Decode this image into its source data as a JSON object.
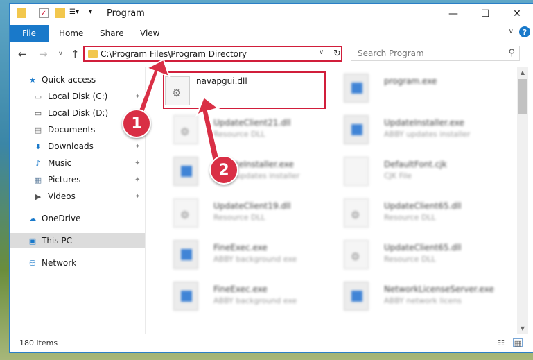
{
  "window": {
    "title": "Program",
    "controls": {
      "minimize": "—",
      "maximize": "☐",
      "close": "✕"
    }
  },
  "ribbon": {
    "file_label": "File",
    "tabs": [
      "Home",
      "Share",
      "View"
    ],
    "help": "?",
    "collapse": "∨"
  },
  "nav": {
    "back": "←",
    "forward": "→",
    "recent": "∨",
    "up": "↑",
    "address": "C:\\Program Files\\Program Directory",
    "address_dropdown": "∨",
    "refresh": "↻",
    "search_placeholder": "Search Program",
    "search_icon": "⚲"
  },
  "sidebar": {
    "items": [
      {
        "label": "Quick access",
        "icon": "★",
        "pinned": false
      },
      {
        "label": "Local Disk (C:)",
        "icon": "▭",
        "pinned": true
      },
      {
        "label": "Local Disk (D:)",
        "icon": "▭",
        "pinned": false
      },
      {
        "label": "Documents",
        "icon": "▤",
        "pinned": true
      },
      {
        "label": "Downloads",
        "icon": "⬇",
        "pinned": true
      },
      {
        "label": "Music",
        "icon": "♪",
        "pinned": true
      },
      {
        "label": "Pictures",
        "icon": "▦",
        "pinned": true
      },
      {
        "label": "Videos",
        "icon": "▶",
        "pinned": true
      },
      {
        "label": "OneDrive",
        "icon": "☁",
        "pinned": false
      },
      {
        "label": "This PC",
        "icon": "▣",
        "pinned": false
      },
      {
        "label": "Network",
        "icon": "⛁",
        "pinned": false
      }
    ],
    "pin_glyph": "📌"
  },
  "files": {
    "featured": {
      "name": "navapgui.dll"
    },
    "others": [
      {
        "name": "program.exe",
        "type": ""
      },
      {
        "name": "UpdateClient21.dll",
        "type": "Resource DLL"
      },
      {
        "name": "UpdateInstaller.exe",
        "type": "ABBY updates installer"
      },
      {
        "name": "UpdateInstaller.exe",
        "type": "ABBY updates installer"
      },
      {
        "name": "DefaultFont.cjk",
        "type": "CJK File"
      },
      {
        "name": "UpdateClient19.dll",
        "type": "Resource DLL"
      },
      {
        "name": "UpdateClient65.dll",
        "type": "Resource DLL"
      },
      {
        "name": "FineExec.exe",
        "type": "ABBY background exe"
      },
      {
        "name": "UpdateClient65.dll",
        "type": "Resource DLL"
      },
      {
        "name": "FineExec.exe",
        "type": "ABBY background exe"
      },
      {
        "name": "NetworkLicenseServer.exe",
        "type": "ABBY network licens"
      }
    ]
  },
  "status": {
    "items_count": "180 items"
  },
  "annotations": {
    "step1": "1",
    "step2": "2"
  },
  "colors": {
    "accent": "#1979ca",
    "highlight": "#d11e3b",
    "badge": "#d92f45"
  }
}
